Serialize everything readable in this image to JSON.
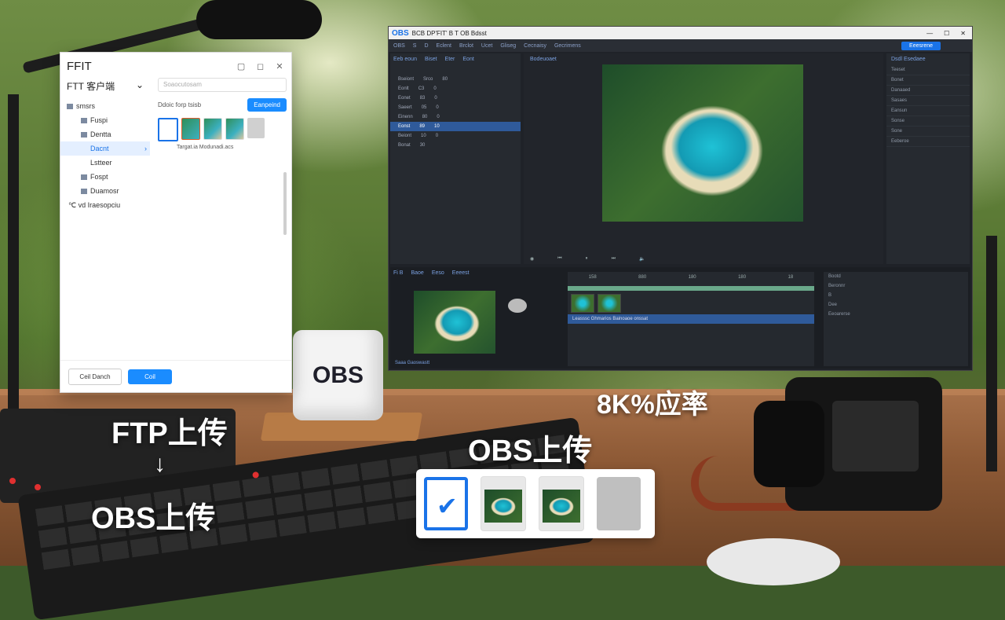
{
  "ftp": {
    "title": "FFIT",
    "window_buttons": [
      "▢",
      "◻",
      "✕"
    ],
    "sidebar_header": "FTT 客户端",
    "search_placeholder": "Soaocutosam",
    "tree": [
      {
        "label": "smsrs",
        "selected": false
      },
      {
        "label": "Fuspi",
        "selected": false
      },
      {
        "label": "Dentta",
        "selected": false
      },
      {
        "label": "Dacnt",
        "selected": true
      },
      {
        "label": "Lstteer",
        "selected": false
      },
      {
        "label": "Fospt",
        "selected": false
      },
      {
        "label": "Duamosr",
        "selected": false
      },
      {
        "label": "℃ vd Iraesopciu",
        "selected": false
      }
    ],
    "path_label": "Ddoic forp tsisb",
    "upload_button": "Eanpeind",
    "file_caption": "Targat.ia  Modunadi.acs",
    "cancel_button": "Ceil Danch",
    "ok_button": "Coil"
  },
  "obs": {
    "logo": "OBS",
    "title": "BCB DP'FIT' B  T  OB Bdsst",
    "window_buttons": [
      "—",
      "☐",
      "✕"
    ],
    "menu": [
      "OBS",
      "S",
      "D",
      "Eclent",
      "Brclot",
      "Ucet",
      "Gliseg",
      "Cecnaisy",
      "Gecrimens"
    ],
    "menu_button": "Eeesrene",
    "left_tabs": [
      "Eeb eoun",
      "Biset",
      "Eter",
      "Eont"
    ],
    "scene_rows": [
      {
        "name": "Bseiont",
        "a": "Srco",
        "b": "80",
        "selected": false
      },
      {
        "name": "Eonlt",
        "a": "C3",
        "b": "0",
        "selected": false
      },
      {
        "name": "Eonet",
        "a": "83",
        "b": "0",
        "selected": false
      },
      {
        "name": "Saeert",
        "a": "05",
        "b": "0",
        "selected": false
      },
      {
        "name": "Einenn",
        "a": "80",
        "b": "0",
        "selected": false
      },
      {
        "name": "Eonst",
        "a": "89",
        "b": "10",
        "selected": true
      },
      {
        "name": "Beiont",
        "a": "10",
        "b": "0",
        "selected": false
      },
      {
        "name": "Bonat",
        "a": "30",
        "b": "",
        "selected": false
      }
    ],
    "preview_header": "Bodeuoaet",
    "right_header": "Dsdl Esedaee",
    "right_rows": [
      "Teeset",
      "Bonet",
      "Danaaed",
      "Sasaes",
      "Eansun",
      "Sonse",
      "Sone",
      "Eeberoe"
    ],
    "bottom_tabs": [
      "Fi B",
      "Baoe",
      "Eeso",
      "Eeeest"
    ],
    "timeline_marks": [
      "158",
      "880",
      "180",
      "180",
      "18"
    ],
    "timeline_track": "Leasssc Ghmarios  Bainoaoe onssat",
    "props": [
      "Bootd",
      "Beronnr",
      "B",
      "Dee",
      "Eeoarerse"
    ],
    "footer": "Saaa  Gaoswastt"
  },
  "captions": {
    "ftp_upload": "FTP上传",
    "arrow": "↓",
    "obs_upload_left": "OBS上传",
    "obs_upload_right": "OBS上传",
    "ratio": "8K%应率"
  },
  "cube_label": "OBS"
}
